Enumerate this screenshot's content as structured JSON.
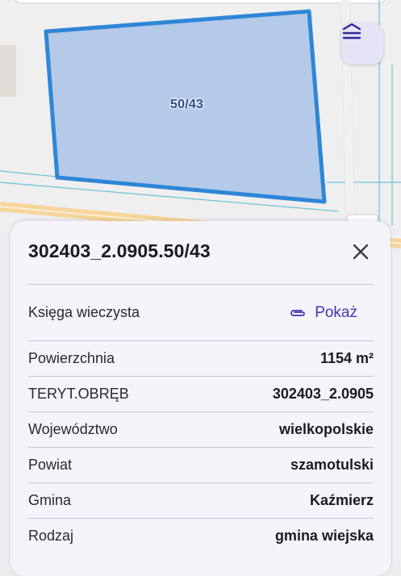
{
  "map": {
    "parcel_label": "50/43"
  },
  "icons": {
    "layers": "layers-icon",
    "close": "close-icon",
    "attachment": "paperclip-icon"
  },
  "colors": {
    "parcel_fill": "#b4cae8",
    "parcel_stroke": "#2e86d6",
    "accent": "#3f3ab3",
    "sheet_bg": "#f6f3fa"
  },
  "sheet": {
    "title": "302403_2.0905.50/43",
    "land_register": {
      "label": "Księga wieczysta",
      "action": "Pokaż"
    },
    "rows": [
      {
        "label": "Powierzchnia",
        "value": "1154 m²"
      },
      {
        "label": "TERYT.OBRĘB",
        "value": "302403_2.0905"
      },
      {
        "label": "Województwo",
        "value": "wielkopolskie"
      },
      {
        "label": "Powiat",
        "value": "szamotulski"
      },
      {
        "label": "Gmina",
        "value": "Kaźmierz"
      },
      {
        "label": "Rodzaj",
        "value": "gmina wiejska"
      }
    ]
  }
}
